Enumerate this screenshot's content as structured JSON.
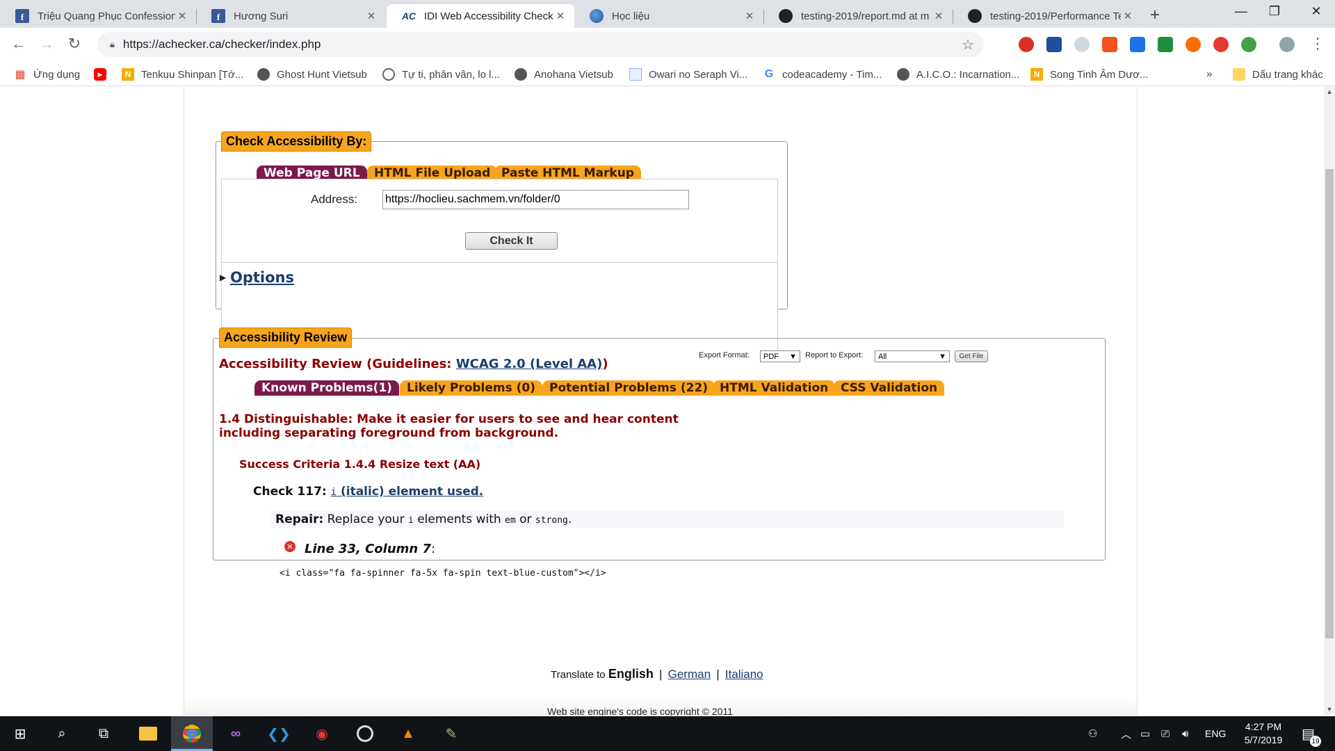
{
  "browser": {
    "tabs": [
      {
        "title": "Triệu Quang Phục Confession",
        "icon": "facebook-icon"
      },
      {
        "title": "Hương Suri",
        "icon": "facebook-icon"
      },
      {
        "title": "IDI Web Accessibility Checker",
        "icon": "achecker-icon",
        "active": true
      },
      {
        "title": "Học liệu",
        "icon": "globe-icon"
      },
      {
        "title": "testing-2019/report.md at m",
        "icon": "github-icon"
      },
      {
        "title": "testing-2019/Performance Te",
        "icon": "github-icon"
      }
    ],
    "url": "https://achecker.ca/checker/index.php",
    "bookmarks": [
      {
        "label": "Ứng dụng",
        "icon": "apps-grid-icon"
      },
      {
        "label": "",
        "icon": "youtube-icon"
      },
      {
        "label": "Tenkuu Shinpan [Tớ...",
        "icon": "n-icon"
      },
      {
        "label": "Ghost Hunt Vietsub",
        "icon": "anime-icon"
      },
      {
        "label": "Tự ti, phân vân, lo l...",
        "icon": "globe-icon"
      },
      {
        "label": "Anohana Vietsub",
        "icon": "anime-icon"
      },
      {
        "label": "Owari no Seraph Vi...",
        "icon": "page-icon"
      },
      {
        "label": "codeacademy - Tim...",
        "icon": "google-icon"
      },
      {
        "label": "A.I.C.O.: Incarnation...",
        "icon": "anime-icon"
      },
      {
        "label": "Song Tinh Âm Dươ...",
        "icon": "n-icon"
      }
    ],
    "bookmarks_more": "»",
    "other_bookmarks": "Dấu trang khác"
  },
  "checker": {
    "legend": "Check Accessibility By:",
    "tabs": [
      "Web Page URL",
      "HTML File Upload",
      "Paste HTML Markup"
    ],
    "address_label": "Address:",
    "address_value": "https://hoclieu.sachmem.vn/folder/0",
    "check_button": "Check It",
    "options_link": "Options"
  },
  "review": {
    "legend": "Accessibility Review",
    "export_format_label": "Export Format:",
    "export_format_value": "PDF",
    "report_label": "Report to Export:",
    "report_value": "All",
    "get_file": "Get File",
    "heading_prefix": "Accessibility Review (Guidelines: ",
    "guideline_link": "WCAG 2.0 (Level AA)",
    "heading_suffix": ")",
    "tabs": [
      "Known Problems(1)",
      "Likely Problems (0)",
      "Potential Problems (22)",
      "HTML Validation",
      "CSS Validation"
    ],
    "principle_line1": "1.4 Distinguishable: Make it easier for users to see and hear content",
    "principle_line2": "including separating foreground from background.",
    "success_criteria": "Success Criteria 1.4.4 Resize text (AA)",
    "check_label": "Check 117:",
    "check_link_code": "i",
    "check_link_text": " (italic) element used.",
    "repair_label": "Repair:",
    "repair_t1": " Replace your ",
    "repair_c1": "i",
    "repair_t2": " elements with ",
    "repair_c2": "em",
    "repair_t3": " or ",
    "repair_c3": "strong",
    "repair_t4": ".",
    "location": "Line 33, Column 7",
    "location_colon": ":",
    "code_snippet": "<i class=\"fa fa-spinner fa-5x fa-spin text-blue-custom\"></i>"
  },
  "footer": {
    "translate_label": "Translate to ",
    "current_lang": "English",
    "sep": "|",
    "langs": [
      "German",
      "Italiano"
    ],
    "copyright": "Web site engine's code is copyright © 2011"
  },
  "taskbar": {
    "language": "ENG",
    "time": "4:27 PM",
    "date": "5/7/2019",
    "notifications": "19"
  }
}
